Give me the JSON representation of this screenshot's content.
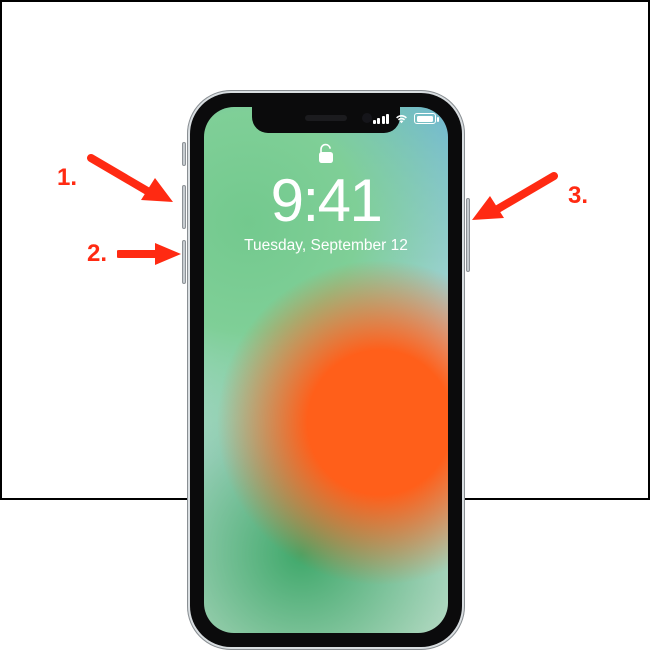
{
  "colors": {
    "accent": "#ff2a12"
  },
  "lockscreen": {
    "time": "9:41",
    "date": "Tuesday, September 12",
    "lock_state": "unlocked"
  },
  "status": {
    "signal_bars": 4,
    "wifi": true,
    "battery_percent": 82
  },
  "buttons": {
    "mute_switch": "mute-switch",
    "volume_up": "volume-up-button",
    "volume_down": "volume-down-button",
    "side_button": "side-button"
  },
  "callouts": [
    {
      "id": 1,
      "label": "1.",
      "target": "volume-up-button",
      "side": "left"
    },
    {
      "id": 2,
      "label": "2.",
      "target": "volume-down-button",
      "side": "left"
    },
    {
      "id": 3,
      "label": "3.",
      "target": "side-button",
      "side": "right"
    }
  ],
  "icons": {
    "signal": "cellular-signal-icon",
    "wifi": "wifi-icon",
    "battery": "battery-icon",
    "lock": "unlock-icon"
  }
}
